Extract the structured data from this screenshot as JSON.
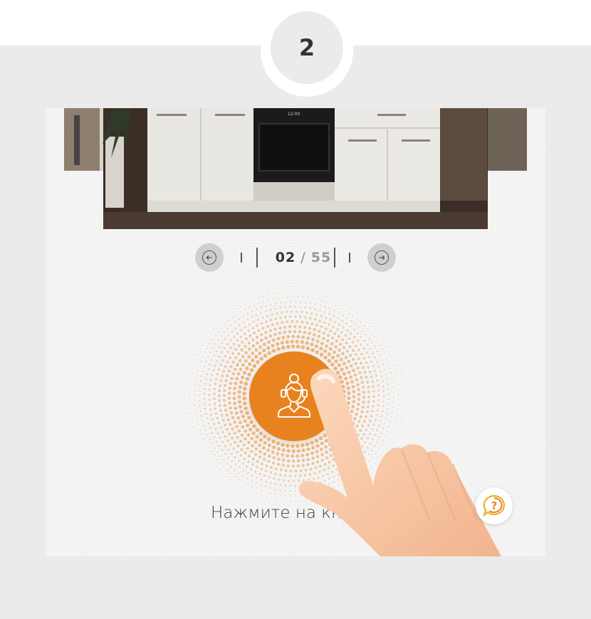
{
  "step": {
    "number": "2"
  },
  "pager": {
    "current": "02",
    "separator": "/",
    "total": "55",
    "prev_icon": "arrow-left-circle-icon",
    "next_icon": "arrow-right-circle-icon"
  },
  "operator_button": {
    "icon": "headset-operator-icon",
    "color": "#e8821e"
  },
  "hint": {
    "text": "Нажмите на кно"
  },
  "help_button": {
    "icon": "question-chat-icon",
    "color": "#f2a51a"
  },
  "photo": {
    "subject": "kitchen-cabinets-oven"
  }
}
